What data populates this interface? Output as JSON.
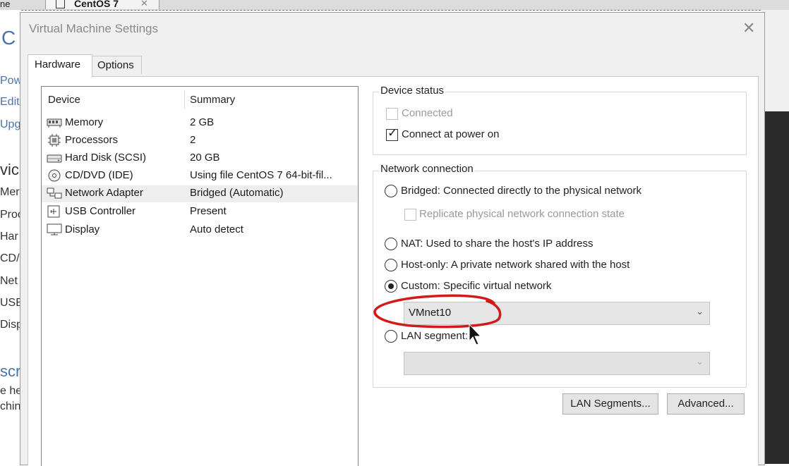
{
  "background": {
    "menu_fragment": "ne",
    "tab_title": "CentOS 7",
    "tab_close": "✕",
    "sidebar_fragments": [
      "C",
      "Pow",
      "Edit",
      "Upg",
      "vic",
      "Mer",
      "Proc",
      "Har",
      "CD/",
      "Net",
      "USB",
      "Disp",
      "scr",
      "e he",
      "chin"
    ]
  },
  "dialog": {
    "title": "Virtual Machine Settings",
    "close_glyph": "✕",
    "tabs": [
      {
        "label": "Hardware",
        "active": true
      },
      {
        "label": "Options",
        "active": false
      }
    ]
  },
  "device_list": {
    "headers": {
      "device": "Device",
      "summary": "Summary"
    },
    "rows": [
      {
        "icon": "memory-icon",
        "device": "Memory",
        "summary": "2 GB",
        "selected": false
      },
      {
        "icon": "processor-icon",
        "device": "Processors",
        "summary": "2",
        "selected": false
      },
      {
        "icon": "hard-disk-icon",
        "device": "Hard Disk (SCSI)",
        "summary": "20 GB",
        "selected": false
      },
      {
        "icon": "cd-dvd-icon",
        "device": "CD/DVD (IDE)",
        "summary": "Using file CentOS 7 64-bit-fil...",
        "selected": false
      },
      {
        "icon": "network-adapter-icon",
        "device": "Network Adapter",
        "summary": "Bridged (Automatic)",
        "selected": true
      },
      {
        "icon": "usb-controller-icon",
        "device": "USB Controller",
        "summary": "Present",
        "selected": false
      },
      {
        "icon": "display-icon",
        "device": "Display",
        "summary": "Auto detect",
        "selected": false
      }
    ]
  },
  "device_status": {
    "title": "Device status",
    "connected": {
      "label": "Connected",
      "checked": false,
      "enabled": false
    },
    "connect_at_power_on": {
      "label": "Connect at power on",
      "checked": true,
      "enabled": true
    }
  },
  "network_connection": {
    "title": "Network connection",
    "bridged": {
      "label": "Bridged: Connected directly to the physical network",
      "selected": false
    },
    "replicate": {
      "label": "Replicate physical network connection state",
      "checked": false,
      "enabled": false
    },
    "nat": {
      "label": "NAT: Used to share the host's IP address",
      "selected": false
    },
    "host_only": {
      "label": "Host-only: A private network shared with the host",
      "selected": false
    },
    "custom": {
      "label": "Custom: Specific virtual network",
      "selected": true
    },
    "custom_value": "VMnet10",
    "lan_segment": {
      "label": "LAN segment:",
      "selected": false
    },
    "lan_segment_value": ""
  },
  "buttons": {
    "lan_segments": "LAN Segments...",
    "advanced": "Advanced..."
  },
  "colors": {
    "annotation": "#d11a1a",
    "dialog_bg": "#f0f0f0",
    "selected_row": "#eeeeee"
  }
}
